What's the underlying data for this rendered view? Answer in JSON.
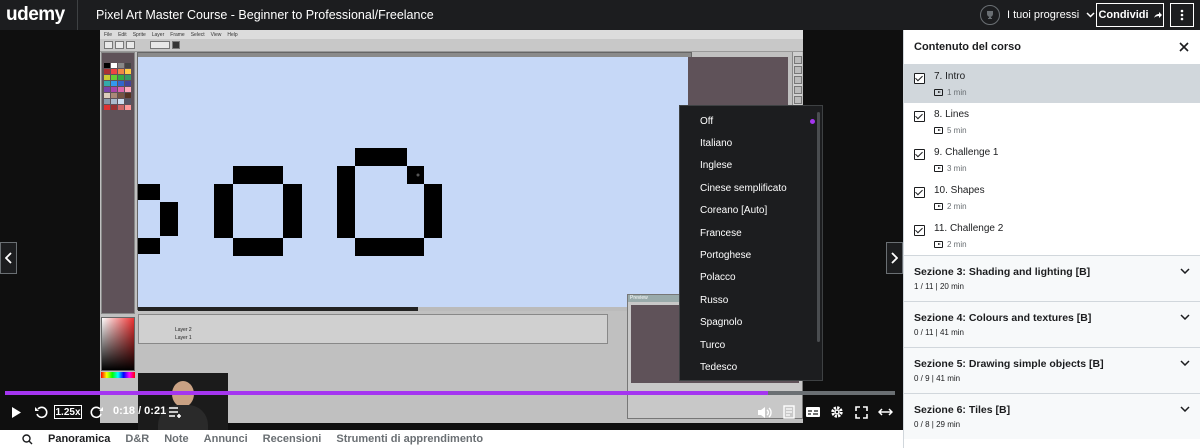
{
  "header": {
    "logo": "udemy",
    "course_title": "Pixel Art Master Course - Beginner to Professional/Freelance",
    "progress_label": "I tuoi progressi",
    "share_label": "Condividi"
  },
  "app_window": {
    "menu": [
      "File",
      "Edit",
      "Sprite",
      "Layer",
      "Frame",
      "Select",
      "View",
      "Help"
    ],
    "layers": [
      "Layer 2",
      "Layer 1"
    ],
    "preview_title": "Preview"
  },
  "player": {
    "playback_rate": "1.25x",
    "time": "0:18 / 0:21",
    "progress_fraction": 0.857
  },
  "captions_menu": {
    "items": [
      "Off",
      "Italiano",
      "Inglese",
      "Cinese semplificato",
      "Coreano [Auto]",
      "Francese",
      "Portoghese",
      "Polacco",
      "Russo",
      "Spagnolo",
      "Turco",
      "Tedesco"
    ],
    "selected": "Off"
  },
  "tabs": [
    "Panoramica",
    "D&R",
    "Note",
    "Annunci",
    "Recensioni",
    "Strumenti di apprendimento"
  ],
  "sidebar": {
    "title": "Contenuto del corso",
    "lectures": [
      {
        "title": "7. Intro",
        "duration": "1 min",
        "current": true
      },
      {
        "title": "8. Lines",
        "duration": "5 min"
      },
      {
        "title": "9. Challenge 1",
        "duration": "3 min"
      },
      {
        "title": "10. Shapes",
        "duration": "2 min"
      },
      {
        "title": "11. Challenge 2",
        "duration": "2 min"
      }
    ],
    "sections": [
      {
        "title": "Sezione 3: Shading and lighting [B]",
        "meta": "1 / 11 | 20 min"
      },
      {
        "title": "Sezione 4: Colours and textures [B]",
        "meta": "0 / 11 | 41 min"
      },
      {
        "title": "Sezione 5: Drawing simple objects [B]",
        "meta": "0 / 9 | 41 min"
      },
      {
        "title": "Sezione 6: Tiles [B]",
        "meta": "0 / 8 | 29 min"
      }
    ]
  },
  "colors": {
    "accent": "#a435f0",
    "dark": "#1c1d1f"
  }
}
